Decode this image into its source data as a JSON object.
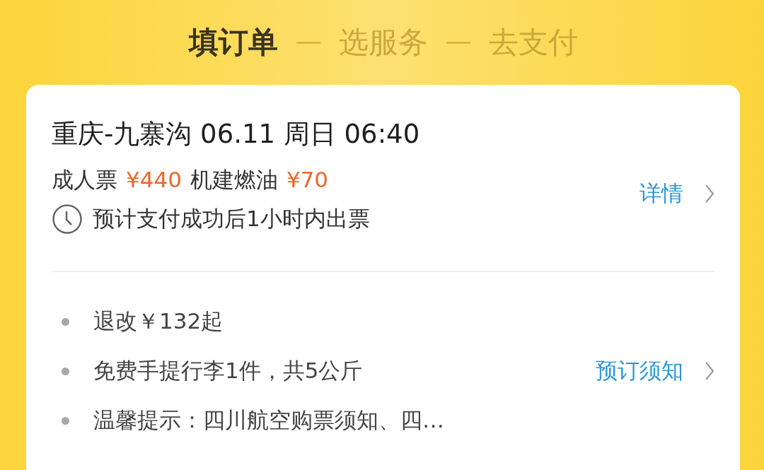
{
  "steps": [
    {
      "label": "填订单",
      "selected": true
    },
    {
      "label": "选服务",
      "selected": false
    },
    {
      "label": "去支付",
      "selected": false
    }
  ],
  "flight": {
    "title": "重庆-九寨沟 06.11 周日 06:40",
    "fares": [
      {
        "kind": "label",
        "text": "成人票"
      },
      {
        "kind": "price",
        "text": "¥440"
      },
      {
        "kind": "label",
        "text": "机建燃油"
      },
      {
        "kind": "price",
        "text": "¥70"
      }
    ],
    "ticketing_note": "预计支付成功后1小时内出票",
    "details_link": "详情"
  },
  "notes": [
    {
      "text": "退改￥132起"
    },
    {
      "text": "免费手提行李1件，共5公斤",
      "link": "预订须知"
    },
    {
      "text": "温馨提示：四川航空购票须知、四…"
    }
  ]
}
